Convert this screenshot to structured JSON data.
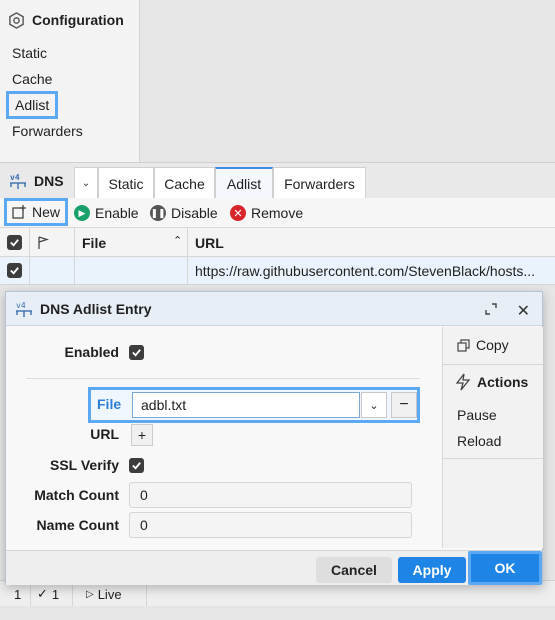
{
  "config": {
    "title": "Configuration",
    "items": [
      "Static",
      "Cache",
      "Adlist",
      "Forwarders"
    ]
  },
  "dns": {
    "title": "DNS",
    "tabs": [
      "Static",
      "Cache",
      "Adlist",
      "Forwarders"
    ]
  },
  "toolbar": {
    "new": "New",
    "enable": "Enable",
    "disable": "Disable",
    "remove": "Remove"
  },
  "grid": {
    "headers": {
      "file": "File",
      "url": "URL"
    },
    "rows": [
      {
        "file": "",
        "url": "https://raw.githubusercontent.com/StevenBlack/hosts..."
      }
    ]
  },
  "status": {
    "count1": "1",
    "count2": "1",
    "live": "Live"
  },
  "dialog": {
    "title": "DNS Adlist Entry",
    "enabled_label": "Enabled",
    "file_label": "File",
    "file_value": "adbl.txt",
    "url_label": "URL",
    "ssl_label": "SSL Verify",
    "match_label": "Match Count",
    "match_value": "0",
    "name_label": "Name Count",
    "name_value": "0",
    "copy": "Copy",
    "actions": "Actions",
    "pause": "Pause",
    "reload": "Reload",
    "cancel": "Cancel",
    "apply": "Apply",
    "ok": "OK"
  },
  "colors": {
    "highlight": "#5aa9f2",
    "primary": "#1e84e6",
    "enable": "#1aa16b",
    "remove": "#d9262c"
  }
}
